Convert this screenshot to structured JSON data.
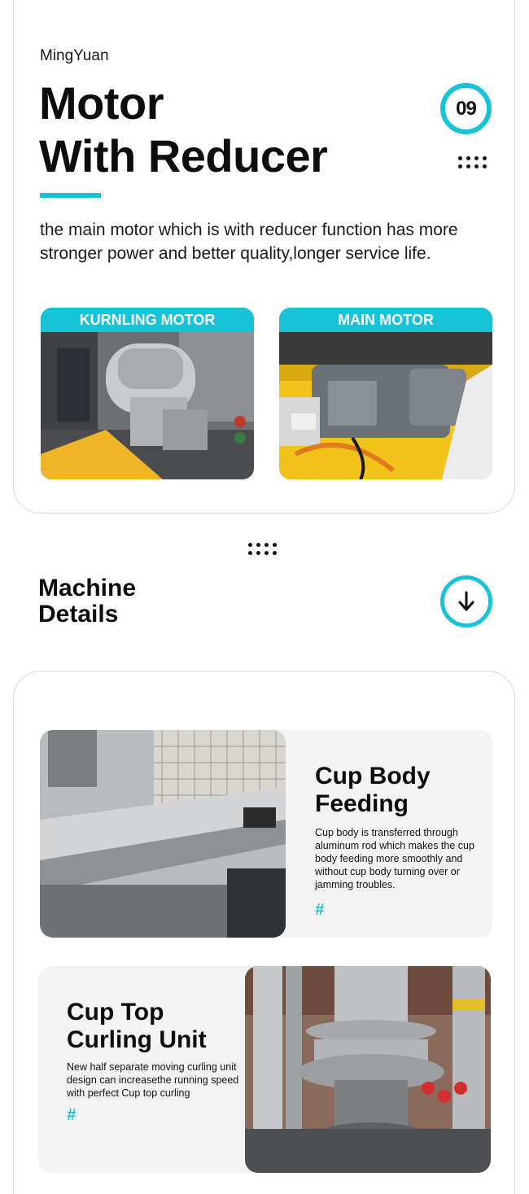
{
  "header": {
    "brand": "MingYuan",
    "title_line1": "Motor",
    "title_line2": "With Reducer",
    "number": "09",
    "description": "the main motor which is with reducer function has more stronger power and better quality,longer service life."
  },
  "photos": [
    {
      "label": "KURNLING MOTOR"
    },
    {
      "label": "MAIN MOTOR"
    }
  ],
  "section": {
    "title_line1": "Machine",
    "title_line2": "Details"
  },
  "details": [
    {
      "title_line1": "Cup Body",
      "title_line2": "Feeding",
      "text": "Cup body is transferred through aluminum rod which makes the cup body feeding more smoothly and without cup body turning over or jamming troubles.",
      "mark": "#"
    },
    {
      "title_line1": "Cup Top",
      "title_line2": "Curling Unit",
      "text": "New half separate moving curling unit design can increasethe running speed with perfect Cup top curling",
      "mark": "#"
    }
  ],
  "colors": {
    "accent": "#17c3d6",
    "text": "#111111",
    "panel": "#f3f3f3"
  },
  "icons": [
    "dots-icon",
    "arrow-down-icon"
  ]
}
